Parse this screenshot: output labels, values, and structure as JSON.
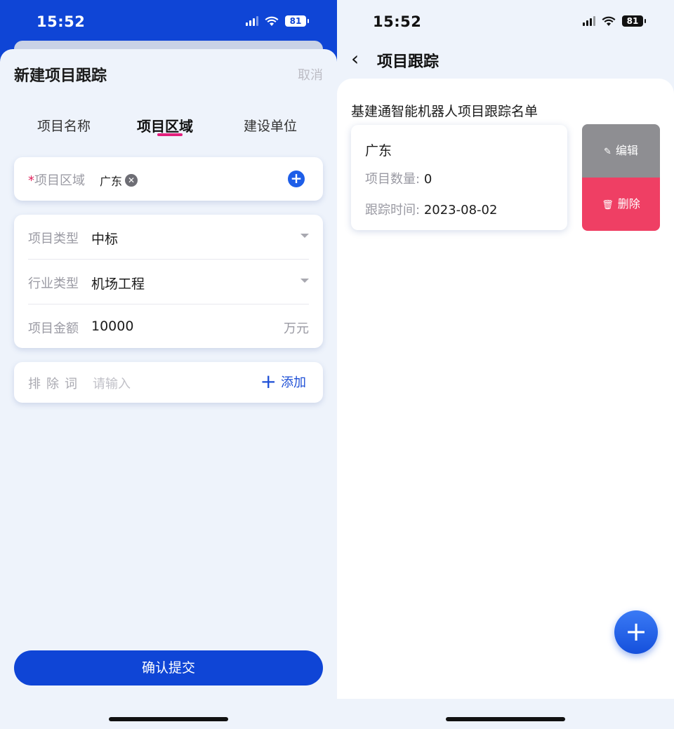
{
  "left": {
    "status_time": "15:52",
    "battery": "81",
    "sheet_title": "新建项目跟踪",
    "cancel_label": "取消",
    "tabs": [
      {
        "label": "项目名称"
      },
      {
        "label": "项目区域"
      },
      {
        "label": "建设单位"
      }
    ],
    "active_tab": "项目区域",
    "region": {
      "required_mark": "*",
      "label": "项目区域",
      "chip": "广东"
    },
    "fields": [
      {
        "label": "项目类型",
        "value": "中标"
      },
      {
        "label": "行业类型",
        "value": "机场工程"
      },
      {
        "label": "项目金额",
        "value": "10000",
        "unit": "万元"
      }
    ],
    "exclude": {
      "label": "排除词",
      "placeholder": "请输入",
      "add_label": "添加"
    },
    "submit_label": "确认提交"
  },
  "right": {
    "status_time": "15:52",
    "battery": "81",
    "nav_title": "项目跟踪",
    "list_title": "基建通智能机器人项目跟踪名单",
    "items": [
      {
        "name": "广东",
        "count_label": "项目数量:",
        "count_value": "0",
        "time_label": "跟踪时间:",
        "time_value": "2023-08-02"
      }
    ],
    "actions": {
      "edit_label": "编辑",
      "delete_label": "删除"
    }
  },
  "colors": {
    "primary": "#0f45d6",
    "accent_underline": "#e21f7c",
    "delete": "#ef3f64",
    "edit": "#8e8e92",
    "page_bg": "#eef3fb"
  },
  "icons": [
    "signal-icon",
    "wifi-icon",
    "battery-icon",
    "clear-chip-icon",
    "add-circle-icon",
    "dropdown-caret-icon",
    "plus-icon",
    "back-chevron-icon",
    "pencil-icon",
    "trash-icon",
    "fab-plus-icon"
  ]
}
